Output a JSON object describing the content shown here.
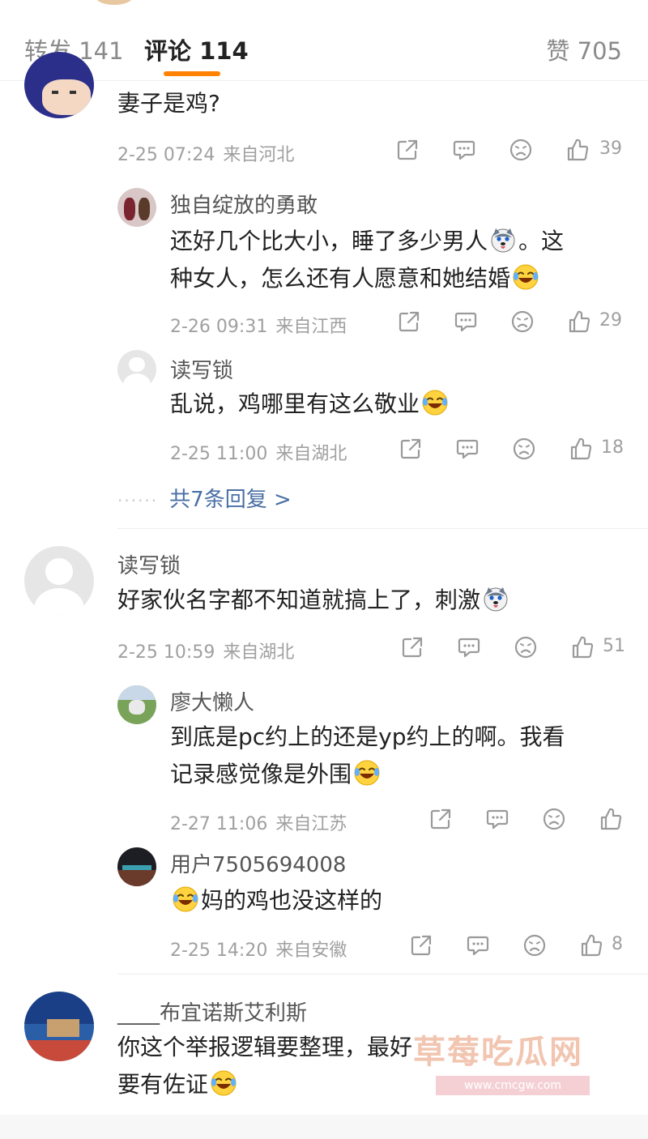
{
  "tabs": {
    "repost": "转发 141",
    "comment": "评论 114",
    "like": "赞 705"
  },
  "comments": [
    {
      "text": "妻子是鸡?",
      "time": "2-25 07:24",
      "location": "来自河北",
      "likes": "39",
      "replies": [
        {
          "name": "独自绽放的勇敢",
          "text1": "还好几个比大小，睡了多少男人",
          "text1b": "。这",
          "text2": "种女人，怎么还有人愿意和她结婚",
          "time": "2-26 09:31",
          "location": "来自江西",
          "likes": "29"
        },
        {
          "name": "读写锁",
          "text1": "乱说，鸡哪里有这么敬业",
          "time": "2-25 11:00",
          "location": "来自湖北",
          "likes": "18"
        }
      ],
      "more_replies": "共7条回复 >"
    },
    {
      "name": "读写锁",
      "text": "好家伙名字都不知道就搞上了，刺激",
      "time": "2-25 10:59",
      "location": "来自湖北",
      "likes": "51",
      "replies": [
        {
          "name": "廖大懒人",
          "text1": "到底是pc约上的还是yp约上的啊。我看",
          "text2": "记录感觉像是外围",
          "time": "2-27 11:06",
          "location": "来自江苏",
          "likes": ""
        },
        {
          "name": "用户7505694008",
          "text1": "妈的鸡也没这样的",
          "time": "2-25 14:20",
          "location": "来自安徽",
          "likes": "8"
        }
      ]
    },
    {
      "name": "____布宜诺斯艾利斯",
      "text1": "你这个举报逻辑要整理，最好",
      "text2": "要有佐证"
    }
  ],
  "watermark": {
    "text": "草莓吃瓜网",
    "url": "www.cmcgw.com"
  },
  "colors": {
    "accent": "#ff8200",
    "link": "#4a6fa5"
  },
  "icons": [
    "share-icon",
    "comment-icon",
    "dislike-icon",
    "thumbs-up-icon",
    "emoji-laugh-cry-icon",
    "emoji-husky-icon"
  ]
}
